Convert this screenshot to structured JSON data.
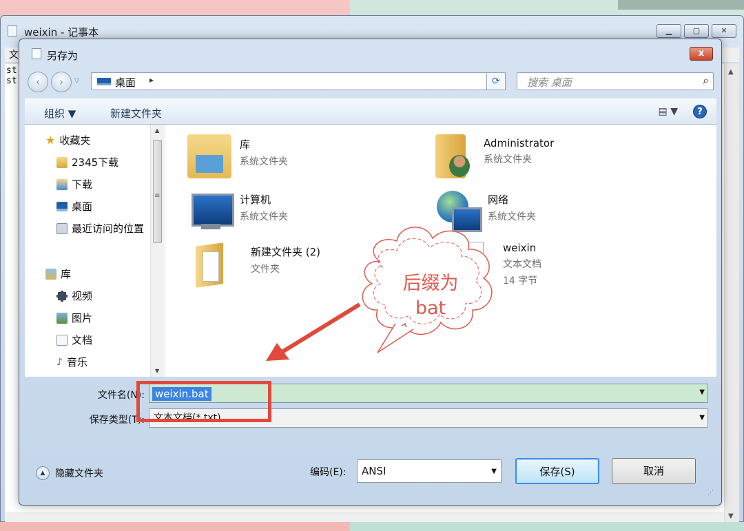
{
  "notepad": {
    "title": "weixin - 记事本",
    "min_btn": "▁",
    "max_btn": "▢",
    "close_btn": "✕",
    "menu_initial": "文",
    "content_lines": [
      "st",
      "st"
    ]
  },
  "dialog": {
    "title": "另存为",
    "close_label": "x",
    "nav": {
      "back": "‹",
      "forward": "›",
      "address": "桌面",
      "address_sep": "▸",
      "address_dropdown": "▾",
      "refresh": "⟳",
      "search_placeholder": "搜索 桌面",
      "search_icon": "⌕"
    },
    "toolbar": {
      "organize": "组织 ▼",
      "new_folder": "新建文件夹",
      "views": "▤ ▼",
      "help": "?"
    },
    "nav_pane": {
      "favorites": "收藏夹",
      "items": [
        "2345下载",
        "下载",
        "桌面",
        "最近访问的位置"
      ],
      "libraries": "库",
      "lib_items": [
        "视频",
        "图片",
        "文档",
        "音乐"
      ]
    },
    "files": [
      {
        "name": "库",
        "type": "系统文件夹",
        "icon": "library-icon"
      },
      {
        "name": "Administrator",
        "type": "系统文件夹",
        "icon": "user-folder-icon"
      },
      {
        "name": "计算机",
        "type": "系统文件夹",
        "icon": "computer-icon"
      },
      {
        "name": "网络",
        "type": "系统文件夹",
        "icon": "network-icon"
      },
      {
        "name": "新建文件夹 (2)",
        "type": "文件夹",
        "icon": "folder-icon"
      },
      {
        "name": "weixin",
        "type": "文本文档",
        "size": "14 字节",
        "icon": "text-file-icon"
      }
    ],
    "filename_label": "文件名(N):",
    "filename_value": "weixin.bat",
    "savetype_label": "保存类型(T):",
    "savetype_value": "文本文档(*.txt)",
    "hide_folders": "隐藏文件夹",
    "encoding_label": "编码(E):",
    "encoding_value": "ANSI",
    "save_button": "保存(S)",
    "cancel_button": "取消"
  },
  "annotation": {
    "callout_line1": "后缀为",
    "callout_line2": "bat",
    "color": "#e04a3c"
  }
}
